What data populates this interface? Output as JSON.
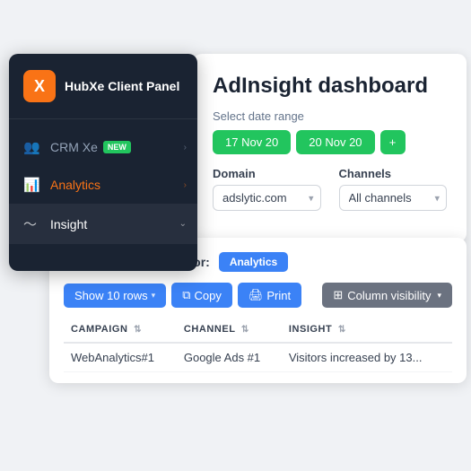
{
  "sidebar": {
    "logo_letter": "X",
    "title": "HubXe Client Panel",
    "items": [
      {
        "id": "crm",
        "label": "CRM Xe",
        "icon": "👥",
        "badge": "NEW",
        "has_badge": true
      },
      {
        "id": "analytics",
        "label": "Analytics",
        "icon": "📊",
        "active": true
      },
      {
        "id": "insight",
        "label": "Insight",
        "icon": "〜",
        "expanded": true
      }
    ]
  },
  "main": {
    "title": "AdInsight dashboard",
    "date_range_label": "Select date range",
    "date_start": "17 Nov 20",
    "date_end": "20 Nov 20",
    "domain_label": "Domain",
    "domain_value": "adslytic.com",
    "channels_label": "Channels",
    "channels_value": "All channels"
  },
  "campaign_card": {
    "title_prefix": "Campaign AdInsight for:",
    "badge_label": "Analytics",
    "toolbar": {
      "rows_btn": "Show 10 rows",
      "copy_btn": "Copy",
      "print_btn": "Print",
      "col_vis_btn": "Column visibility"
    },
    "table": {
      "columns": [
        {
          "key": "campaign",
          "label": "CAMPAIGN"
        },
        {
          "key": "channel",
          "label": "CHANNEL"
        },
        {
          "key": "insight",
          "label": "INSIGHT"
        }
      ],
      "rows": [
        {
          "campaign": "WebAnalytics#1",
          "channel": "Google Ads #1",
          "insight": "Visitors increased by 13..."
        }
      ]
    }
  }
}
